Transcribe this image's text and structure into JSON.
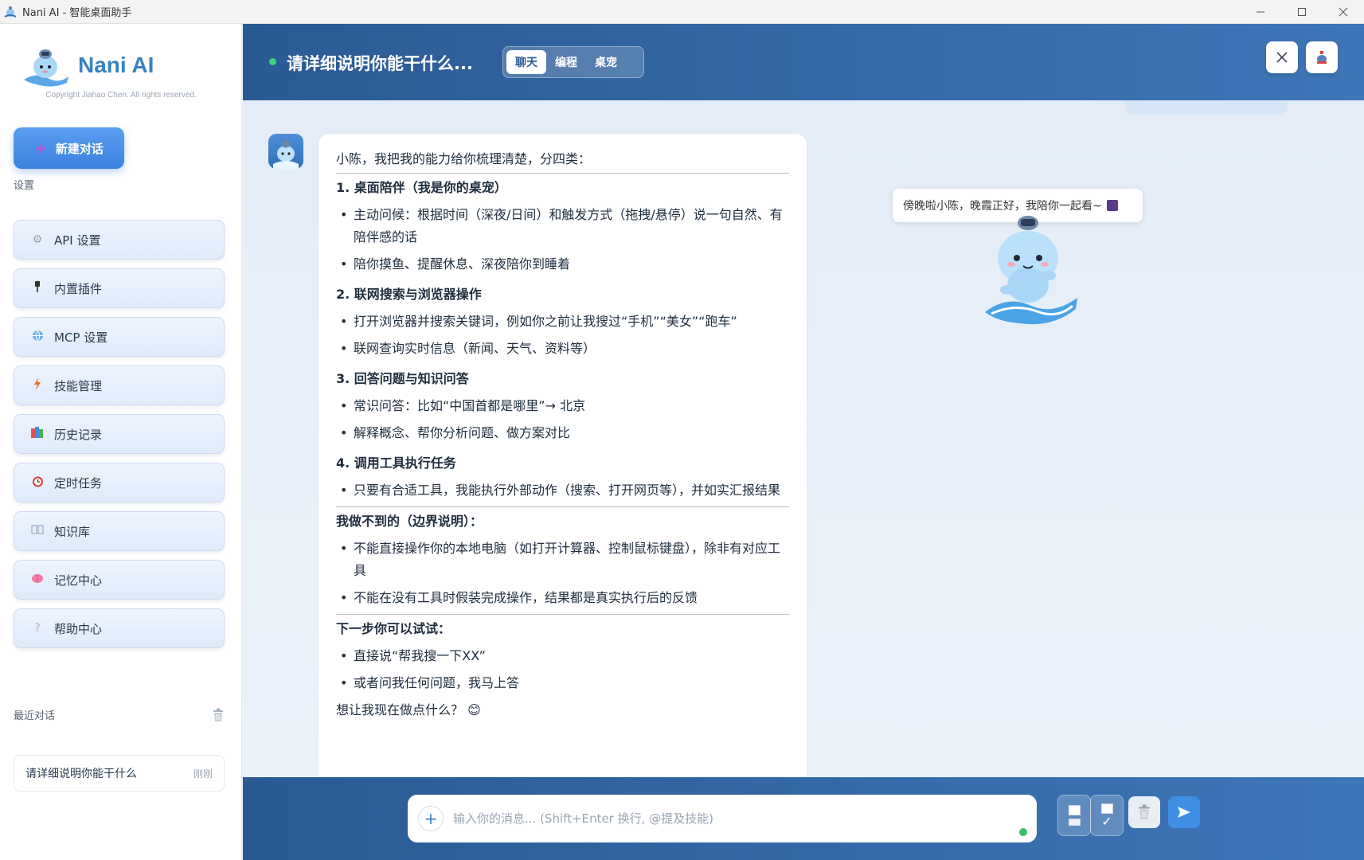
{
  "window": {
    "title": "Nani AI - 智能桌面助手",
    "controls": [
      "minimize",
      "maximize",
      "close"
    ]
  },
  "sidebar": {
    "brand": "Nani AI",
    "copyright": "Copyright Jiahao Chen. All rights reserved.",
    "new_chat_label": "新建对话",
    "settings_label": "设置",
    "items": [
      {
        "label": "API 设置",
        "icon": "gear-icon"
      },
      {
        "label": "内置插件",
        "icon": "plug-icon"
      },
      {
        "label": "MCP 设置",
        "icon": "globe-icon"
      },
      {
        "label": "技能管理",
        "icon": "lightning-icon"
      },
      {
        "label": "历史记录",
        "icon": "books-icon"
      },
      {
        "label": "定时任务",
        "icon": "alarm-clock-icon"
      },
      {
        "label": "知识库",
        "icon": "open-book-icon"
      },
      {
        "label": "记忆中心",
        "icon": "brain-icon"
      },
      {
        "label": "帮助中心",
        "icon": "question-icon"
      }
    ],
    "recent_label": "最近对话",
    "recent_items": [
      {
        "title": "请详细说明你能干什么",
        "time": "刚刚"
      }
    ]
  },
  "header": {
    "title": "请详细说明你能干什么...",
    "tabs": [
      {
        "label": "聊天",
        "active": true
      },
      {
        "label": "编程",
        "active": false
      },
      {
        "label": "桌宠",
        "active": false
      }
    ]
  },
  "message": {
    "intro": "小陈，我把我的能力给你梳理清楚，分四类：",
    "sections": [
      {
        "heading": "1. 桌面陪伴（我是你的桌宠）",
        "items": [
          "主动问候：根据时间（深夜/日间）和触发方式（拖拽/悬停）说一句自然、有陪伴感的话",
          "陪你摸鱼、提醒休息、深夜陪你到睡着"
        ]
      },
      {
        "heading": "2. 联网搜索与浏览器操作",
        "items": [
          "打开浏览器并搜索关键词，例如你之前让我搜过“手机”“美女”“跑车”",
          "联网查询实时信息（新闻、天气、资料等）"
        ]
      },
      {
        "heading": "3. 回答问题与知识问答",
        "items": [
          "常识问答：比如“中国首都是哪里”→ 北京",
          "解释概念、帮你分析问题、做方案对比"
        ]
      },
      {
        "heading": "4. 调用工具执行任务",
        "items": [
          "只要有合适工具，我能执行外部动作（搜索、打开网页等），并如实汇报结果"
        ]
      }
    ],
    "limits_heading": "我做不到的（边界说明）：",
    "limits": [
      "不能直接操作你的本地电脑（如打开计算器、控制鼠标键盘），除非有对应工具",
      "不能在没有工具时假装完成操作，结果都是真实执行后的反馈"
    ],
    "next_heading": "下一步你可以试试：",
    "next": [
      "直接说“帮我搜一下XX”",
      "或者问我任何问题，我马上答"
    ],
    "closing": "想让我现在做点什么？",
    "closing_emoji": "😊"
  },
  "pet": {
    "speech": "傍晚啦小陈，晚霞正好，我陪你一起看~"
  },
  "input": {
    "placeholder": "输入你的消息... (Shift+Enter 换行, @提及技能)",
    "value": ""
  },
  "colors": {
    "accent": "#3b82c4",
    "header_bg": "#2a5a93",
    "status_green": "#3ed17c"
  }
}
